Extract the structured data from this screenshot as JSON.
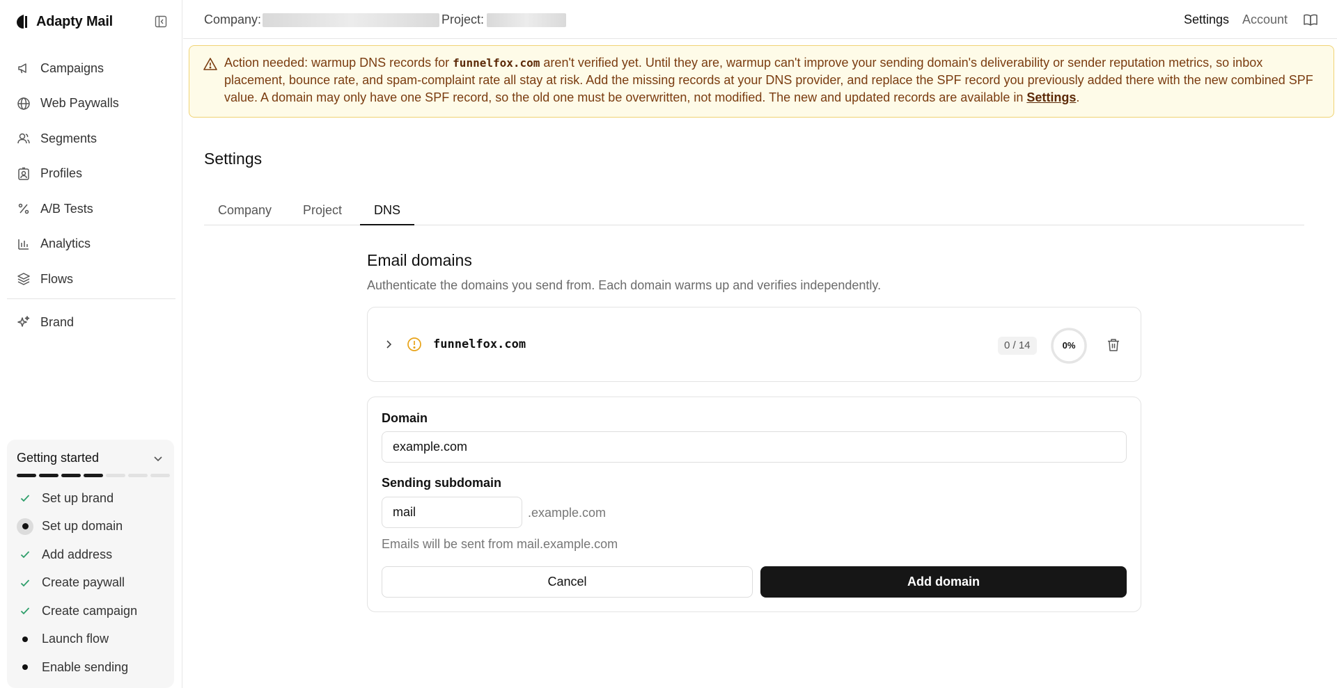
{
  "app": {
    "name": "Adapty Mail",
    "collapse_icon": "sidebar-collapse-icon"
  },
  "sidebar": {
    "items": [
      {
        "label": "Campaigns",
        "icon": "megaphone-icon"
      },
      {
        "label": "Web Paywalls",
        "icon": "globe-icon"
      },
      {
        "label": "Segments",
        "icon": "users-icon"
      },
      {
        "label": "Profiles",
        "icon": "profile-card-icon"
      },
      {
        "label": "A/B Tests",
        "icon": "percent-icon"
      },
      {
        "label": "Analytics",
        "icon": "bar-chart-icon"
      },
      {
        "label": "Flows",
        "icon": "layers-icon"
      }
    ],
    "brand_item": {
      "label": "Brand",
      "icon": "sparkles-icon"
    }
  },
  "getting_started": {
    "title": "Getting started",
    "progress": {
      "done": 4,
      "total": 7
    },
    "steps": [
      {
        "label": "Set up brand",
        "status": "done"
      },
      {
        "label": "Set up domain",
        "status": "current"
      },
      {
        "label": "Add address",
        "status": "done"
      },
      {
        "label": "Create paywall",
        "status": "done"
      },
      {
        "label": "Create campaign",
        "status": "done"
      },
      {
        "label": "Launch flow",
        "status": "todo"
      },
      {
        "label": "Enable sending",
        "status": "todo"
      }
    ]
  },
  "topbar": {
    "company_label": "Company:",
    "project_label": "Project:",
    "settings_link": "Settings",
    "account_link": "Account",
    "docs_icon": "book-icon"
  },
  "alert": {
    "prefix": "Action needed: warmup DNS records for",
    "domain": "funnelfox.com",
    "body": "aren't verified yet. Until they are, warmup can't improve your sending domain's deliverability or sender reputation metrics, so inbox placement, bounce rate, and spam-complaint rate all stay at risk. Add the missing records at your DNS provider, and replace the SPF record you previously added there with the new combined SPF value. A domain may only have one SPF record, so the old one must be overwritten, not modified. The new and updated records are available in",
    "link": "Settings",
    "suffix": ".",
    "icon": "warning-triangle-icon"
  },
  "page": {
    "title": "Settings",
    "tabs": [
      {
        "label": "Company",
        "active": false
      },
      {
        "label": "Project",
        "active": false
      },
      {
        "label": "DNS",
        "active": true
      }
    ]
  },
  "email_domains": {
    "title": "Email domains",
    "subtitle": "Authenticate the domains you send from. Each domain warms up and verifies independently.",
    "domains": [
      {
        "name": "funnelfox.com",
        "records": "0 / 14",
        "progress_label": "0%",
        "progress": 0,
        "status_icon": "warning-circle-icon"
      }
    ]
  },
  "add_domain_form": {
    "domain_label": "Domain",
    "domain_value": "example.com",
    "subdomain_label": "Sending subdomain",
    "subdomain_value": "mail",
    "subdomain_suffix": ".example.com",
    "hint": "Emails will be sent from mail.example.com",
    "cancel_label": "Cancel",
    "submit_label": "Add domain"
  },
  "colors": {
    "alert_bg": "#fefbe8",
    "alert_border": "#f0d374",
    "alert_text": "#7a3c10",
    "warning_orange": "#e8a317",
    "check_green": "#2e9e6a",
    "primary_button": "#161616"
  }
}
